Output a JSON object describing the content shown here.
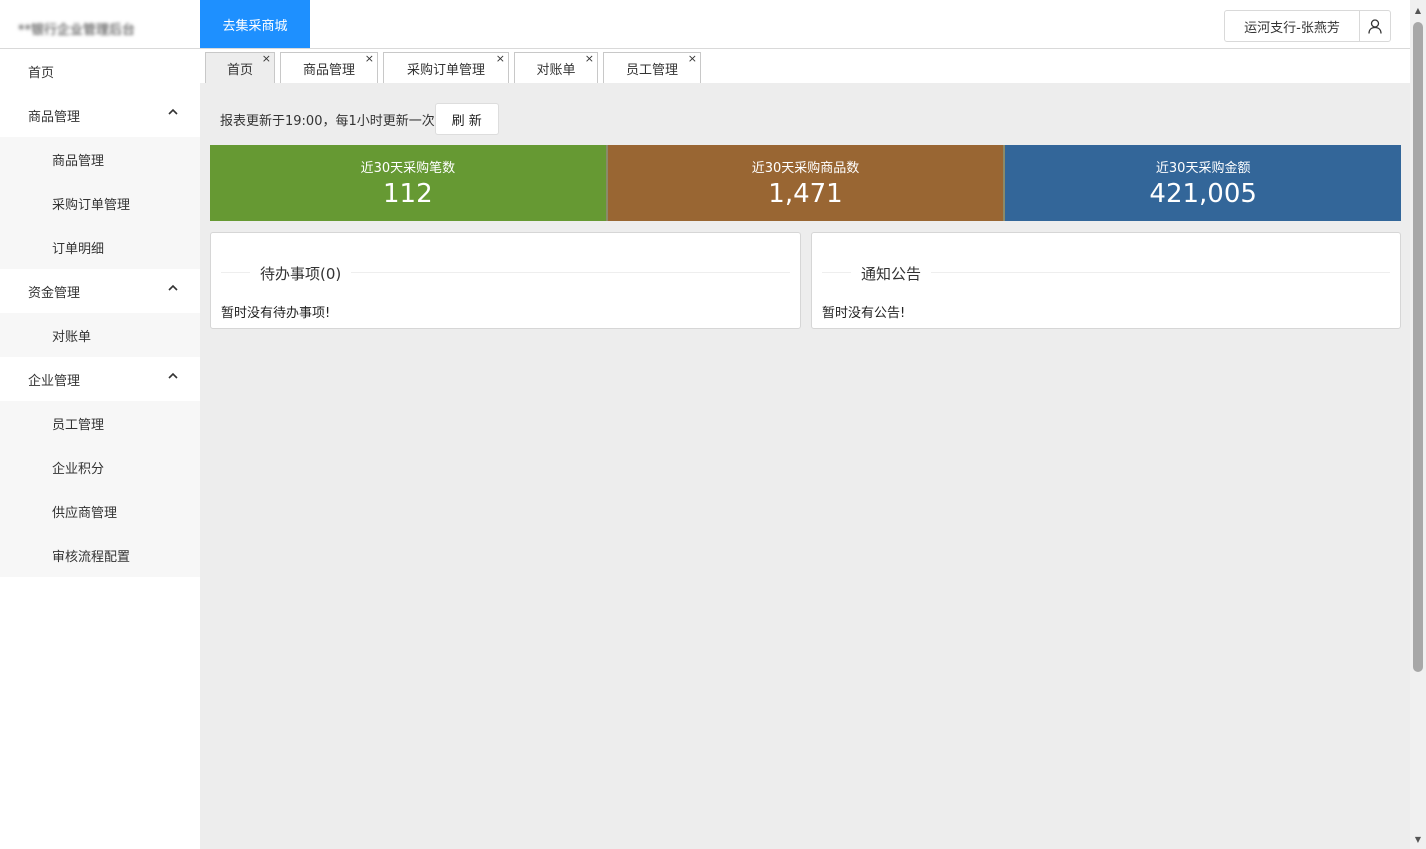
{
  "header": {
    "logo_text": "**银行企业管理后台",
    "mall_button": "去集采商城",
    "user_name": "运河支行-张燕芳",
    "user_icon": "user-icon"
  },
  "sidebar": {
    "home": "首页",
    "groups": [
      {
        "label": "商品管理",
        "items": [
          "商品管理",
          "采购订单管理",
          "订单明细"
        ]
      },
      {
        "label": "资金管理",
        "items": [
          "对账单"
        ]
      },
      {
        "label": "企业管理",
        "items": [
          "员工管理",
          "企业积分",
          "供应商管理",
          "审核流程配置"
        ]
      }
    ]
  },
  "tabs": [
    {
      "label": "首页",
      "active": true
    },
    {
      "label": "商品管理",
      "active": false
    },
    {
      "label": "采购订单管理",
      "active": false
    },
    {
      "label": "对账单",
      "active": false
    },
    {
      "label": "员工管理",
      "active": false
    }
  ],
  "tab_close": "×",
  "report": {
    "update_text": "报表更新于19:00，每1小时更新一次",
    "refresh_button": "刷 新"
  },
  "stats": [
    {
      "label": "近30天采购笔数",
      "value": "112",
      "color": "#669933"
    },
    {
      "label": "近30天采购商品数",
      "value": "1,471",
      "color": "#996633"
    },
    {
      "label": "近30天采购金额",
      "value": "421,005",
      "color": "#336699"
    }
  ],
  "todo": {
    "title": "待办事项(0)",
    "empty": "暂时没有待办事项!"
  },
  "notice": {
    "title": "通知公告",
    "empty": "暂时没有公告!"
  }
}
